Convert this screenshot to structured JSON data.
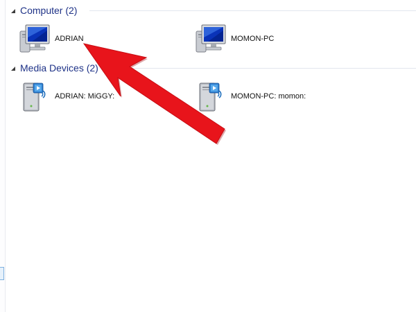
{
  "groups": [
    {
      "title": "Computer (2)",
      "items": [
        {
          "label": "ADRIAN",
          "icon": "computer-monitor-icon"
        },
        {
          "label": "MOMON-PC",
          "icon": "computer-monitor-icon"
        }
      ]
    },
    {
      "title": "Media Devices (2)",
      "items": [
        {
          "label": "ADRIAN: MiGGY:",
          "icon": "media-server-icon"
        },
        {
          "label": "MOMON-PC: momon:",
          "icon": "media-server-icon"
        }
      ]
    }
  ],
  "colors": {
    "group_title": "#1e3287",
    "arrow": "#e8141b",
    "selection_accent": "#7fb1df"
  }
}
